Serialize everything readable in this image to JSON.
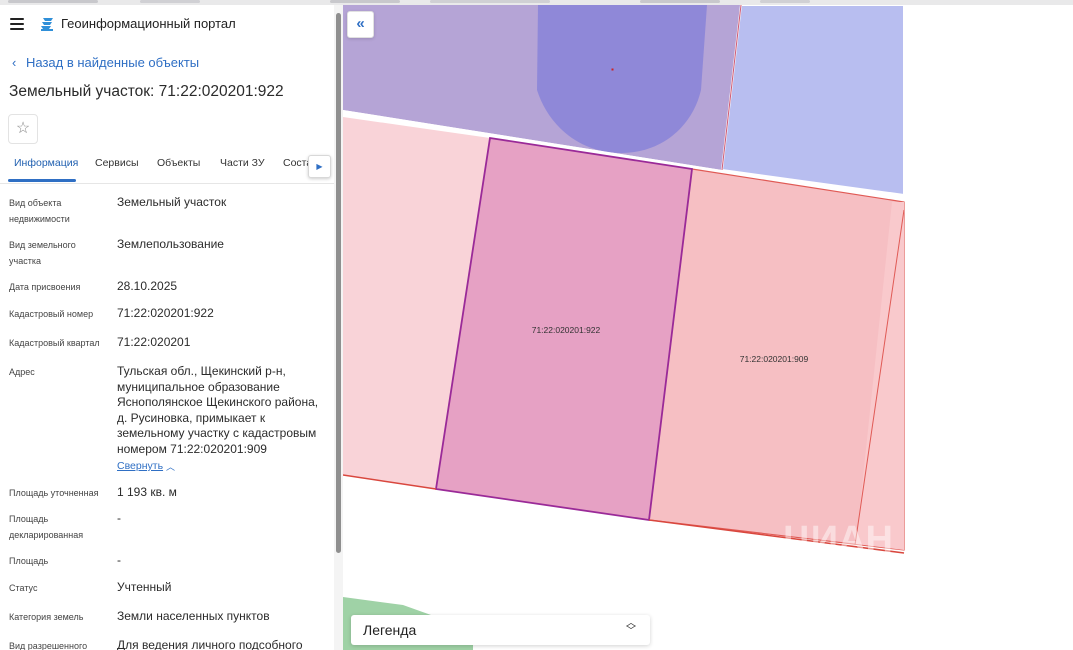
{
  "header": {
    "app_title": "Геоинформационный портал",
    "logo_icon": "portal-logo-icon",
    "menu_icon": "menu-icon"
  },
  "nav": {
    "back_label": "Назад в найденные объекты"
  },
  "object": {
    "title": "Земельный участок: 71:22:020201:922"
  },
  "tabs": [
    {
      "label": "Информация",
      "active": true
    },
    {
      "label": "Сервисы"
    },
    {
      "label": "Объекты"
    },
    {
      "label": "Части ЗУ"
    },
    {
      "label": "Соста"
    }
  ],
  "info": {
    "object_type": {
      "label": "Вид объекта недвижимости",
      "value": "Земельный участок"
    },
    "land_type": {
      "label": "Вид земельного участка",
      "value": "Землепользование"
    },
    "assign_date": {
      "label": "Дата присвоения",
      "value": "28.10.2025"
    },
    "cadastral_number": {
      "label": "Кадастровый номер",
      "value": "71:22:020201:922"
    },
    "cadastral_quarter": {
      "label": "Кадастровый квартал",
      "value": "71:22:020201"
    },
    "address": {
      "label": "Адрес",
      "value": "Тульская обл., Щекинский р-н, муниципальное образование Яснополянское Щекинского района, д. Русиновка, примыкает к земельному участку с кадастровым номером 71:22:020201:909",
      "collapse_label": "Свернуть"
    },
    "area_specified": {
      "label": "Площадь уточненная",
      "value": "1 193 кв. м"
    },
    "area_declared": {
      "label": "Площадь декларированная",
      "value": "-"
    },
    "area": {
      "label": "Площадь",
      "value": "-"
    },
    "status": {
      "label": "Статус",
      "value": "Учтенный"
    },
    "land_category": {
      "label": "Категория земель",
      "value": "Земли населенных пунктов"
    },
    "permitted_use": {
      "label": "Вид разрешенного",
      "value": "Для ведения личного подсобного"
    }
  },
  "map": {
    "parcel_main": "71:22:020201:922",
    "parcel_neighbor": "71:22:020201:909",
    "legend_label": "Легенда",
    "watermark": "ЦИАН",
    "colors": {
      "accent": "#2f6fc4",
      "parcel_selected": "#e6a1c4",
      "parcel_selected_border": "#9a2a98",
      "parcel_neighbor": "#f6bfc3",
      "parcel_light": "#f9d3d8",
      "zone_purple": "#b5a4d6",
      "zone_blue": "#b7bdf0",
      "dome": "#8f88d8",
      "border_red": "#d9473e",
      "green": "#9fd2a6"
    }
  }
}
